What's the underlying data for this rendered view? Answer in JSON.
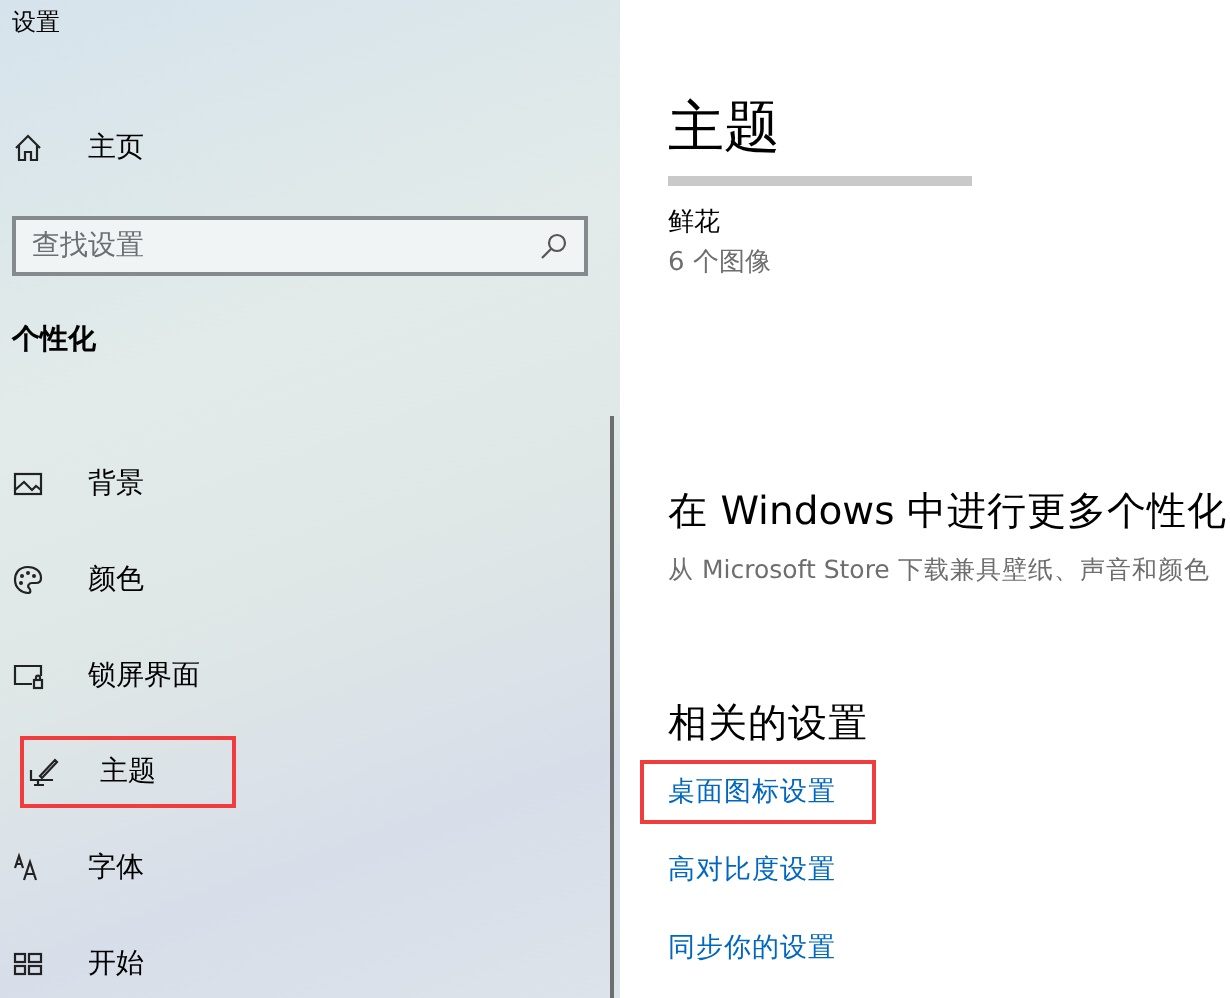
{
  "window": {
    "title": "设置"
  },
  "sidebar": {
    "home": {
      "label": "主页"
    },
    "search": {
      "placeholder": "查找设置"
    },
    "section": "个性化",
    "items": [
      {
        "kind": "background",
        "label": "背景",
        "highlighted": false
      },
      {
        "kind": "colors",
        "label": "颜色",
        "highlighted": false
      },
      {
        "kind": "lockscreen",
        "label": "锁屏界面",
        "highlighted": false
      },
      {
        "kind": "themes",
        "label": "主题",
        "highlighted": true
      },
      {
        "kind": "fonts",
        "label": "字体",
        "highlighted": false
      },
      {
        "kind": "start",
        "label": "开始",
        "highlighted": false
      }
    ]
  },
  "content": {
    "title": "主题",
    "theme": {
      "name": "鲜花",
      "count": "6 个图像"
    },
    "store": {
      "heading": "在 Windows 中进行更多个性化",
      "text": "从 Microsoft Store 下载兼具壁纸、声音和颜色"
    },
    "related": {
      "heading": "相关的设置",
      "links": [
        {
          "label": "桌面图标设置",
          "highlighted": true
        },
        {
          "label": "高对比度设置",
          "highlighted": false
        },
        {
          "label": "同步你的设置",
          "highlighted": false
        }
      ]
    }
  }
}
